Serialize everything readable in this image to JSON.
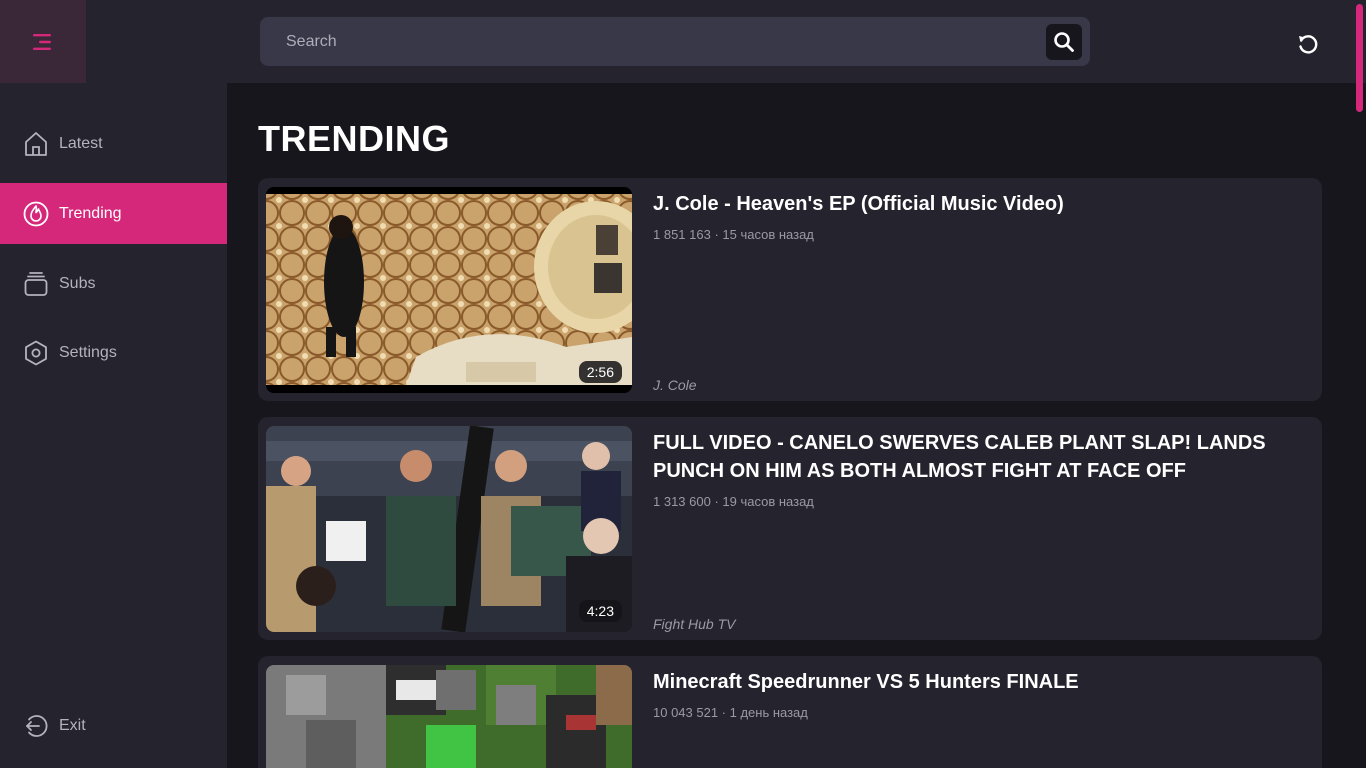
{
  "header": {
    "search_placeholder": "Search"
  },
  "sidebar": {
    "items": [
      {
        "label": "Latest",
        "icon": "home-icon"
      },
      {
        "label": "Trending",
        "icon": "flame-icon",
        "active": true
      },
      {
        "label": "Subs",
        "icon": "subscriptions-icon"
      },
      {
        "label": "Settings",
        "icon": "settings-icon"
      }
    ],
    "exit_label": "Exit"
  },
  "main": {
    "title": "TRENDING",
    "videos": [
      {
        "title": "J. Cole - Heaven's EP (Official Music Video)",
        "meta": "1 851 163 · 15 часов назад",
        "channel": "J. Cole",
        "duration": "2:56"
      },
      {
        "title": "FULL VIDEO - CANELO SWERVES CALEB PLANT SLAP! LANDS PUNCH ON HIM AS BOTH ALMOST FIGHT AT FACE OFF",
        "meta": "1 313 600 · 19 часов назад",
        "channel": "Fight Hub TV",
        "duration": "4:23"
      },
      {
        "title": "Minecraft Speedrunner VS 5 Hunters FINALE",
        "meta": "10 043 521 · 1 день назад",
        "channel": "",
        "duration": ""
      }
    ]
  },
  "colors": {
    "accent": "#d6287a",
    "background": "#17161d",
    "panel": "#24232e"
  }
}
